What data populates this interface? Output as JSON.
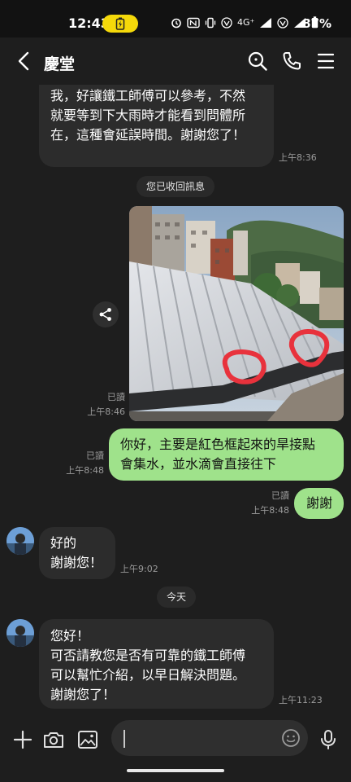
{
  "status_bar": {
    "time": "12:43",
    "network": "4G⁺",
    "battery_percent": "87%"
  },
  "header": {
    "title": "慶堂"
  },
  "messages": {
    "m1": {
      "text": "我，好讓鐵工師傅可以參考，不然\n就要等到下大雨時才能看到問體所\n在，這種會延誤時間。謝謝您了！",
      "time": "上午8:36"
    },
    "recalled": "您已收回訊息",
    "photo": {
      "read": "已讀",
      "time": "上午8:46"
    },
    "m2": {
      "text": "你好，主要是紅色框起來的旱接點\n會集水，並水滴會直接往下",
      "read": "已讀",
      "time": "上午8:48"
    },
    "m3": {
      "text": "謝謝",
      "read": "已讀",
      "time": "上午8:48"
    },
    "m4": {
      "text": "好的\n謝謝您！",
      "time": "上午9:02"
    },
    "date_divider": "今天",
    "m5": {
      "text": "您好！\n可否請教您是否有可靠的鐵工師傅\n可以幫忙介紹，以早日解決問題。\n謝謝您了！",
      "time": "上午11:23"
    }
  },
  "input": {
    "value": ""
  },
  "colors": {
    "outgoing_bubble": "#9fe28b",
    "incoming_bubble": "#2c2c2c",
    "background": "#1e1e1e",
    "battery_pill": "#f5d90a"
  },
  "icons": [
    "back-arrow",
    "search",
    "phone",
    "menu",
    "share",
    "plus",
    "camera",
    "image",
    "emoji",
    "microphone"
  ]
}
